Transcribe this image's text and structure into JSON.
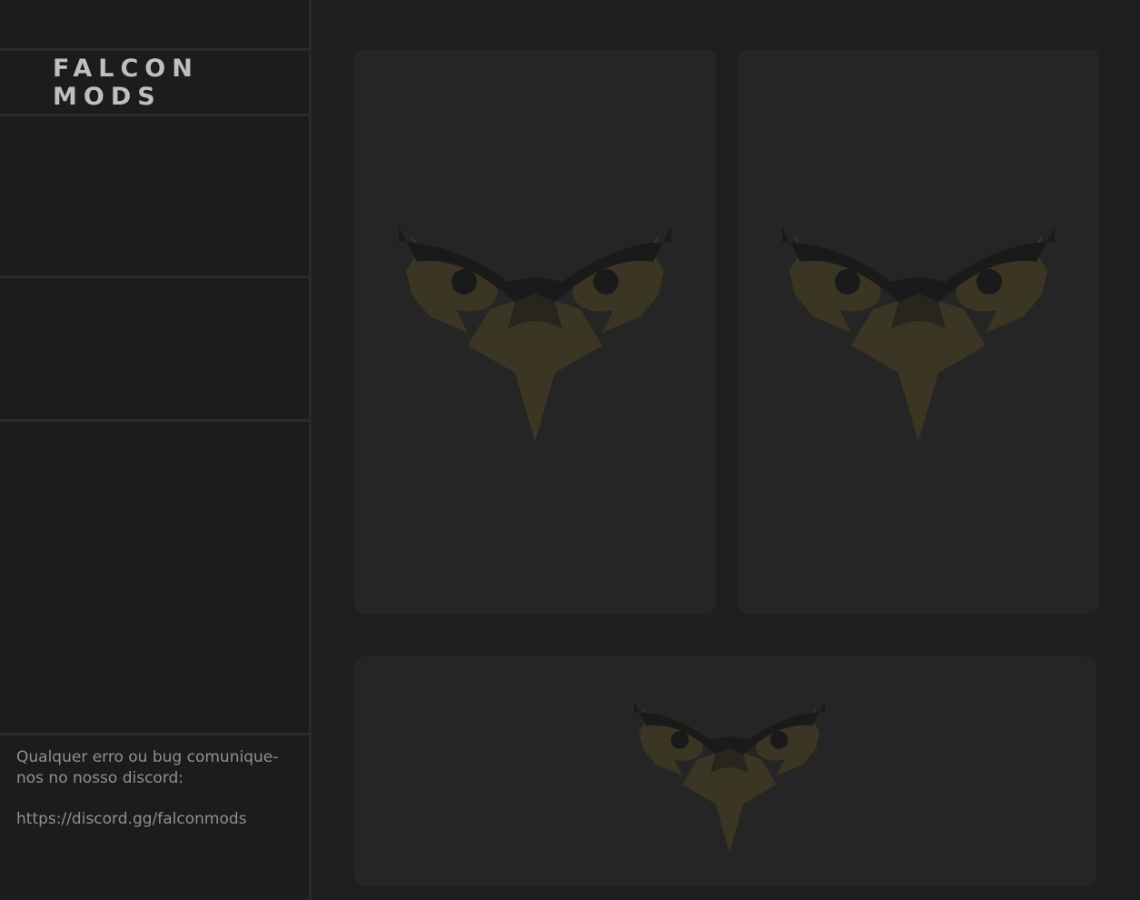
{
  "brand": {
    "name": "FALCON MODS"
  },
  "sidebar": {
    "slots": [
      {
        "id": "slot-1"
      },
      {
        "id": "slot-2"
      },
      {
        "id": "slot-3"
      }
    ]
  },
  "footer": {
    "message": "Qualquer erro ou bug comunique-nos no nosso discord:",
    "link": "https://discord.gg/falconmods"
  },
  "cards": [
    {
      "icon": "falcon-logo-icon"
    },
    {
      "icon": "falcon-logo-icon"
    },
    {
      "icon": "falcon-logo-icon"
    }
  ],
  "colors": {
    "background": "#1d1f1f",
    "sidebar": "#1b1c1c",
    "card": "#252525",
    "logo_gold": "#3a3623",
    "logo_dark": "#1a1a1a",
    "text": "#bfbfbf",
    "footer_text": "#8f9090"
  }
}
